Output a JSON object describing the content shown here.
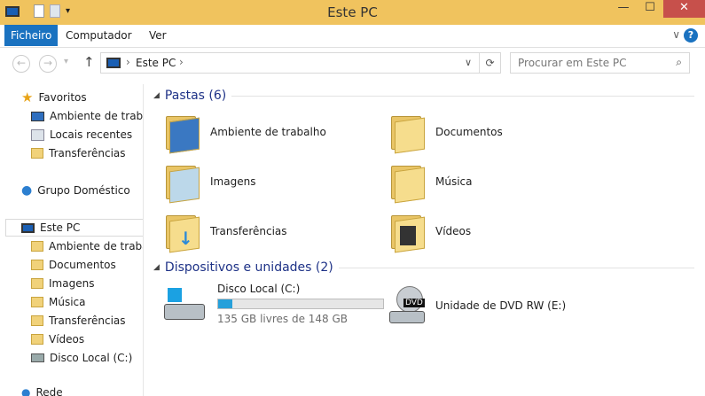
{
  "window": {
    "title": "Este PC",
    "minimize": "—",
    "maximize": "☐",
    "close": "✕"
  },
  "ribbon": {
    "tabs": [
      "Ficheiro",
      "Computador",
      "Ver"
    ],
    "expand": "∨",
    "help": "?"
  },
  "nav": {
    "back": "←",
    "forward": "→",
    "recent": "▾",
    "up": "↑"
  },
  "address": {
    "crumbs": [
      "Este PC"
    ],
    "sep": "›",
    "dropdown": "∨",
    "refresh": "⟳"
  },
  "search": {
    "placeholder": "Procurar em Este PC"
  },
  "sidebar": {
    "favorites": {
      "label": "Favoritos",
      "items": [
        "Ambiente de trabalho",
        "Locais recentes",
        "Transferências"
      ]
    },
    "homegroup": "Grupo Doméstico",
    "thispc": {
      "label": "Este PC",
      "items": [
        "Ambiente de trabalho",
        "Documentos",
        "Imagens",
        "Música",
        "Transferências",
        "Vídeos",
        "Disco Local (C:)"
      ]
    },
    "network": "Rede"
  },
  "main": {
    "folders_header": "Pastas (6)",
    "folders": [
      "Ambiente de trabalho",
      "Documentos",
      "Imagens",
      "Música",
      "Transferências",
      "Vídeos"
    ],
    "devices_header": "Dispositivos e unidades (2)",
    "drives": [
      {
        "name": "Disco Local (C:)",
        "free": "135 GB livres de 148 GB",
        "used_fraction": 0.088
      },
      {
        "name": "Unidade de DVD RW (E:)",
        "badge": "DVD"
      }
    ]
  },
  "colors": {
    "titlebar": "#f0c35e",
    "accent": "#1a72c0",
    "bar": "#26a0da"
  }
}
